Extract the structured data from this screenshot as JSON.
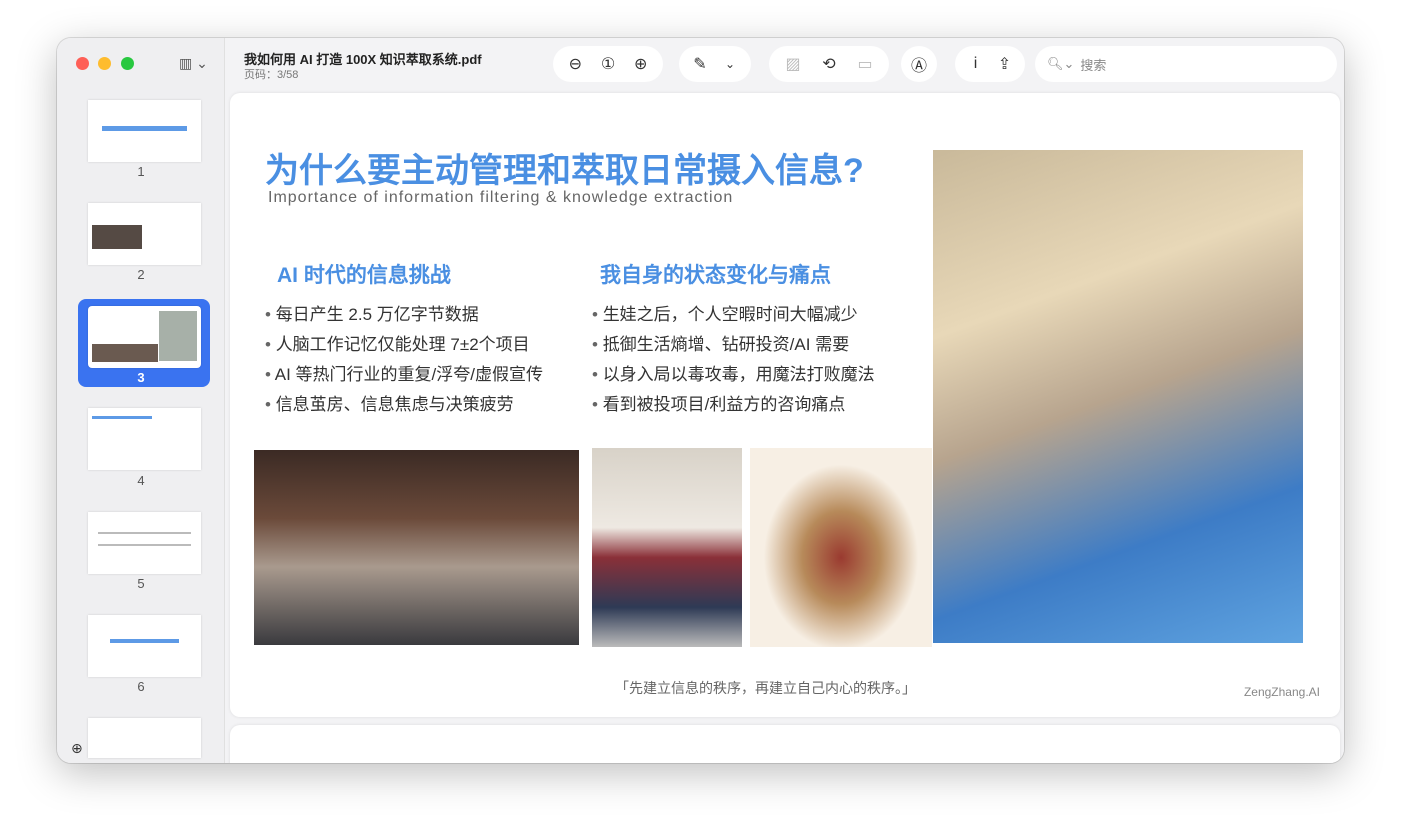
{
  "window": {
    "title": "我如何用 AI 打造 100X 知识萃取系统.pdf",
    "page_indicator": "页码：3/58"
  },
  "toolbar": {
    "search_placeholder": "搜索",
    "info_label": "i"
  },
  "sidebar": {
    "pages": [
      "1",
      "2",
      "3",
      "4",
      "5",
      "6"
    ],
    "selected": "3"
  },
  "slide": {
    "title": "为什么要主动管理和萃取日常摄入信息?",
    "subtitle": "Importance of information filtering & knowledge extraction",
    "left_heading": "AI 时代的信息挑战",
    "left_bullets": [
      "每日产生 2.5 万亿字节数据",
      "人脑工作记忆仅能处理 7±2个项目",
      "AI 等热门行业的重复/浮夸/虚假宣传",
      "信息茧房、信息焦虑与决策疲劳"
    ],
    "right_heading": "我自身的状态变化与痛点",
    "right_bullets": [
      "生娃之后，个人空暇时间大幅减少",
      "抵御生活熵增、钻研投资/AI 需要",
      "以身入局以毒攻毒，用魔法打败魔法",
      "看到被投项目/利益方的咨询痛点"
    ],
    "quote": "「先建立信息的秩序，再建立自己内心的秩序。」",
    "brand": "ZengZhang.AI"
  },
  "colors": {
    "accent": "#4a8fe2",
    "selection": "#3a73f0"
  }
}
